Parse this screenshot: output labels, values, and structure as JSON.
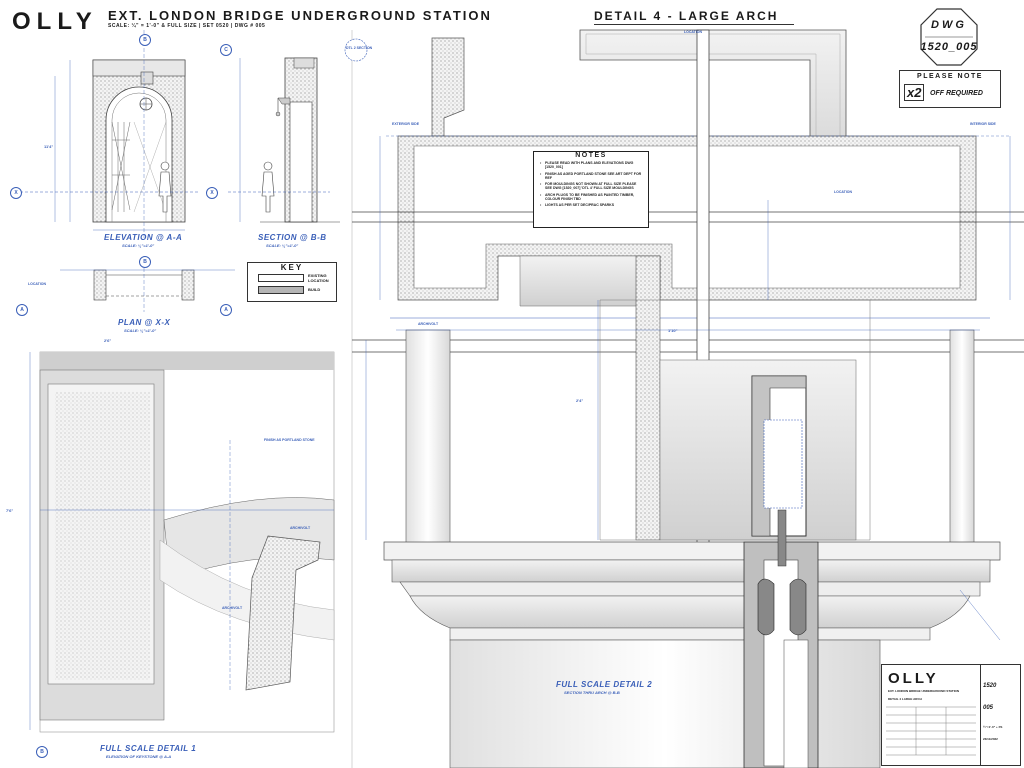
{
  "header": {
    "brand": "OLLY",
    "project_title": "EXT. LONDON BRIDGE UNDERGROUND STATION",
    "project_subtitle": "SCALE: ¼\" = 1'-0\" & FULL SIZE | SET 0520 | DWG # 005",
    "detail_title": "DETAIL 4 - LARGE ARCH"
  },
  "dwg_badge": {
    "label": "DWG",
    "number": "1520_005"
  },
  "please_note": {
    "title": "PLEASE NOTE",
    "count": "x2",
    "text": "OFF REQUIRED"
  },
  "notes": {
    "title": "NOTES",
    "items": [
      "PLEASE READ WITH PLANS AND ELEVATIONS DWG [1520_001]",
      "FINISH AS AGED PORTLAND STONE SEE ART DEPT FOR REF",
      "FOR MOULDINGS NOT SHOWN AT FULL SIZE PLEASE SEE DWG [1520_007] 'DTL 4' FULL SIZE MOULDINGS",
      "ARCH PLUGS TO BE FINISHED AS PAINTED TIMBER, COLOUR FINISH TBD",
      "LIGHTS AS PER SET DEC/PRAC SPARKS"
    ]
  },
  "key": {
    "title": "KEY",
    "items": [
      {
        "label": "EXISTING LOCATION",
        "color": "#ffffff"
      },
      {
        "label": "BUILD",
        "color": "#b5b5b5"
      }
    ]
  },
  "views": {
    "elevation": {
      "title": "ELEVATION @ A-A",
      "scale": "SCALE: ¼\"=1'-0\""
    },
    "section": {
      "title": "SECTION @ B-B",
      "scale": "SCALE: ¼\"=1'-0\""
    },
    "plan": {
      "title": "PLAN @ X-X",
      "scale": "SCALE: ¼\"=1'-0\""
    },
    "detail1": {
      "title": "FULL SCALE DETAIL 1",
      "scale": "ELEVATION OF KEYSTONE @ A-A"
    },
    "detail2": {
      "title": "FULL SCALE DETAIL 2",
      "scale": "SECTION THRU ARCH @ B-B"
    }
  },
  "labels": {
    "location": "LOCATION",
    "exterior": "EXTERIOR SIDE",
    "interior": "INTERIOR SIDE",
    "archivolt": "ARCHIVOLT",
    "finish_portland": "FINISH AS PORTLAND STONE",
    "dtl2_section": "DTL 2 SECTION",
    "dim_a": "7'6\"",
    "dim_b": "2'6\"",
    "dim_c": "11'4\"",
    "dim_d": "1'10\"",
    "dim_e": "2'4\"",
    "ref_a": "A",
    "ref_b": "B",
    "ref_c": "C",
    "ref_x": "X"
  },
  "title_block": {
    "brand": "OLLY",
    "project": "EXT. LONDON BRIDGE UNDERGROUND STATION",
    "drawing": "DETAIL 4 LARGE ARCH",
    "set": "1520",
    "dwg": "005",
    "scale": "¼\"=1'-0\" + FS",
    "date": "23/11/2022"
  }
}
